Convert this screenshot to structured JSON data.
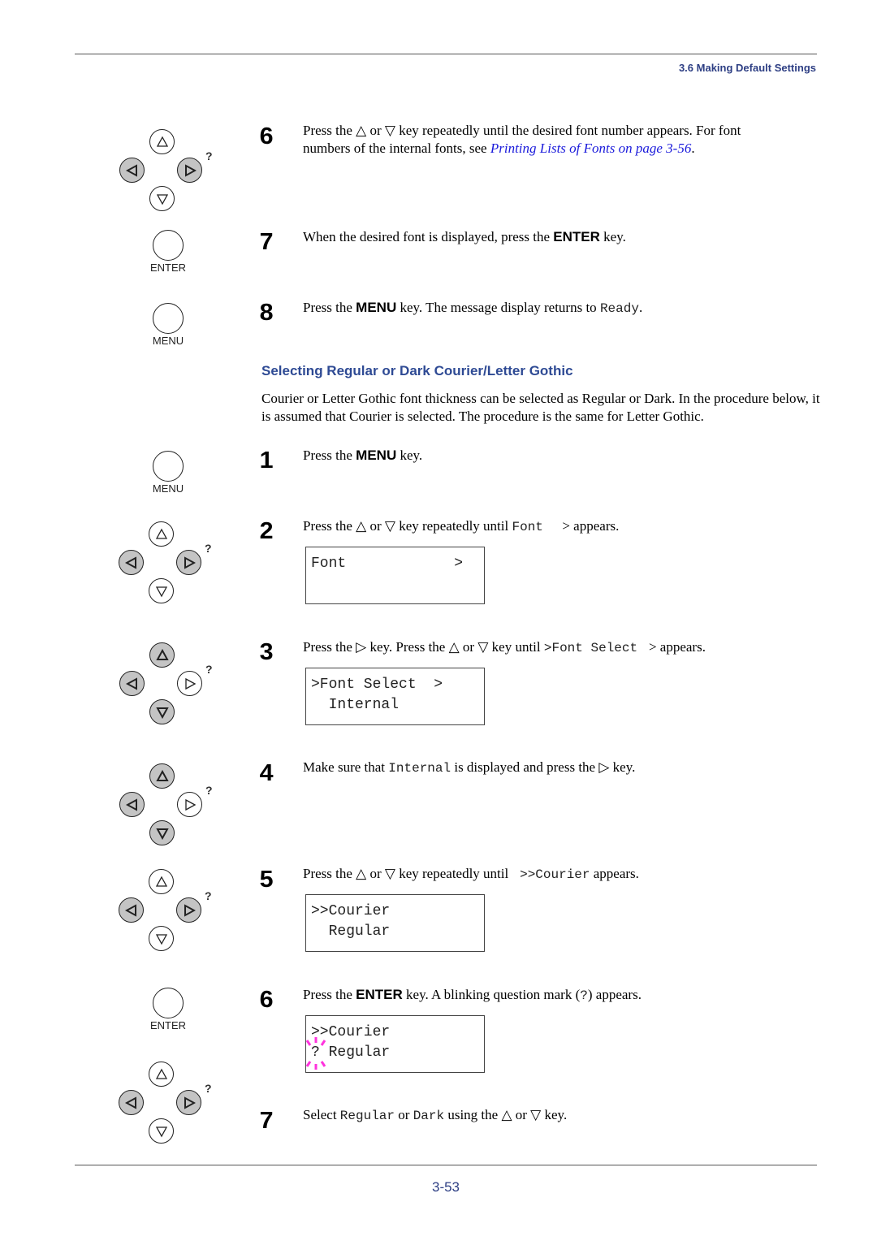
{
  "header": {
    "section_title": "3.6 Making Default Settings"
  },
  "footer": {
    "page_number": "3-53"
  },
  "steps_a": [
    {
      "num": "6",
      "line1": "Press the △ or ▽ key repeatedly until the desired font number appears. For font",
      "line2_prefix": "numbers of the internal fonts, see ",
      "link": "Printing Lists of Fonts on page 3-56",
      "line2_suffix": "."
    },
    {
      "num": "7",
      "pre": "When the desired font is displayed, press the ",
      "key": "ENTER",
      "post": " key."
    },
    {
      "num": "8",
      "pre": "Press the ",
      "key": "MENU",
      "mid": " key. The message display returns to ",
      "mono": "Ready",
      "post": "."
    }
  ],
  "section": {
    "title": "Selecting Regular or Dark Courier/Letter Gothic",
    "intro": "Courier or Letter Gothic font thickness can be selected as Regular or Dark. In the procedure below, it is assumed that Courier is selected. The procedure is the same for Letter Gothic."
  },
  "steps_b": [
    {
      "num": "1",
      "pre": "Press the ",
      "key": "MENU",
      "post": " key."
    },
    {
      "num": "2",
      "pre": "Press the △ or ▽ key repeatedly until ",
      "mono": "Font  ",
      "post": " > appears."
    },
    {
      "num": "3",
      "pre": "Press the ▷ key. Press the △ or ▽ key until ",
      "mono": ">Font Select ",
      "post": " > appears."
    },
    {
      "num": "4",
      "pre": "Make sure that ",
      "mono": "Internal",
      "post": " is displayed and press the ▷ key."
    },
    {
      "num": "5",
      "pre": "Press the △ or ▽ key repeatedly until ",
      "mono": " >>Courier",
      "post": " appears."
    },
    {
      "num": "6",
      "pre": "Press the ",
      "key": "ENTER",
      "mid": " key. A blinking question mark (",
      "mono": "?",
      "post": ") appears."
    },
    {
      "num": "7",
      "pre": "Select ",
      "mono": "Regular",
      "mid": " or ",
      "mono2": "Dark",
      "post": " using the △ or ▽ key."
    }
  ],
  "lcd": {
    "font": {
      "line1": "Font",
      "arrow": ">",
      "line2": ""
    },
    "font_select": {
      "line1": ">Font Select  >",
      "line2": "  Internal"
    },
    "courier": {
      "line1": ">>Courier",
      "line2": "  Regular"
    },
    "courier_q": {
      "line1": ">>Courier",
      "line2": "? Regular"
    }
  },
  "keys": {
    "enter": "ENTER",
    "menu": "MENU",
    "help": "?"
  },
  "colors": {
    "heading_blue": "#2e4a94",
    "link_blue": "#1a1adb",
    "blink_magenta": "#ff33dd",
    "key_gray": "#c4c4c4"
  }
}
